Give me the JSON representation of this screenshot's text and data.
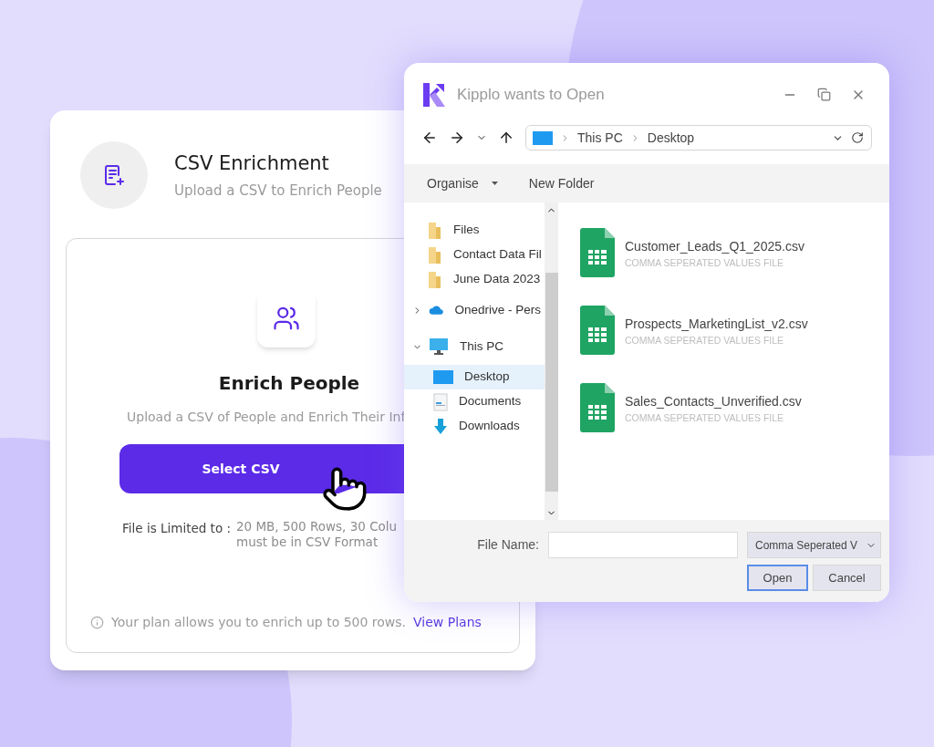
{
  "card": {
    "title": "CSV Enrichment",
    "subtitle": "Upload a CSV to Enrich People",
    "panel": {
      "heading": "Enrich People",
      "description": "Upload a CSV of People and Enrich Their Inf",
      "button": "Select CSV",
      "limits_label": "File is Limited to :",
      "limits_value": [
        "20 MB, 500 Rows, 30 Colu",
        "must be in CSV Format"
      ],
      "note": "Your plan allows you to enrich up to 500 rows.",
      "link": "View Plans"
    }
  },
  "dialog": {
    "title": "Kipplo wants to Open",
    "path": [
      "This PC",
      "Desktop"
    ],
    "toolbar": [
      {
        "label": "Organise",
        "kind": "menu"
      },
      {
        "label": "New Folder",
        "kind": "action"
      }
    ],
    "sidebar": [
      {
        "label": "Files",
        "kind": "folder",
        "selected": false
      },
      {
        "label": "Contact Data Fil",
        "kind": "folder",
        "selected": false
      },
      {
        "label": "June Data 2023",
        "kind": "folder",
        "selected": false
      },
      {
        "label": "Onedrive - Pers",
        "kind": "cloud",
        "expanded": false,
        "selected": false
      },
      {
        "label": "This PC",
        "kind": "pc",
        "expanded": true,
        "selected": false,
        "children": [
          {
            "label": "Desktop",
            "kind": "desktop",
            "selected": true
          },
          {
            "label": "Documents",
            "kind": "documents",
            "selected": false
          },
          {
            "label": "Downloads",
            "kind": "downloads",
            "selected": false
          }
        ]
      }
    ],
    "files": [
      {
        "name": "Customer_Leads_Q1_2025.csv",
        "type": "COMMA SEPERATED VALUES FILE"
      },
      {
        "name": "Prospects_MarketingList_v2.csv",
        "type": "COMMA SEPERATED VALUES FILE"
      },
      {
        "name": "Sales_Contacts_Unverified.csv",
        "type": "COMMA SEPERATED VALUES FILE"
      }
    ],
    "file_name_label": "File Name:",
    "file_type": "Comma Seperated V",
    "buttons": [
      {
        "label": "Open",
        "selected": true
      },
      {
        "label": "Cancel",
        "selected": false
      }
    ]
  }
}
